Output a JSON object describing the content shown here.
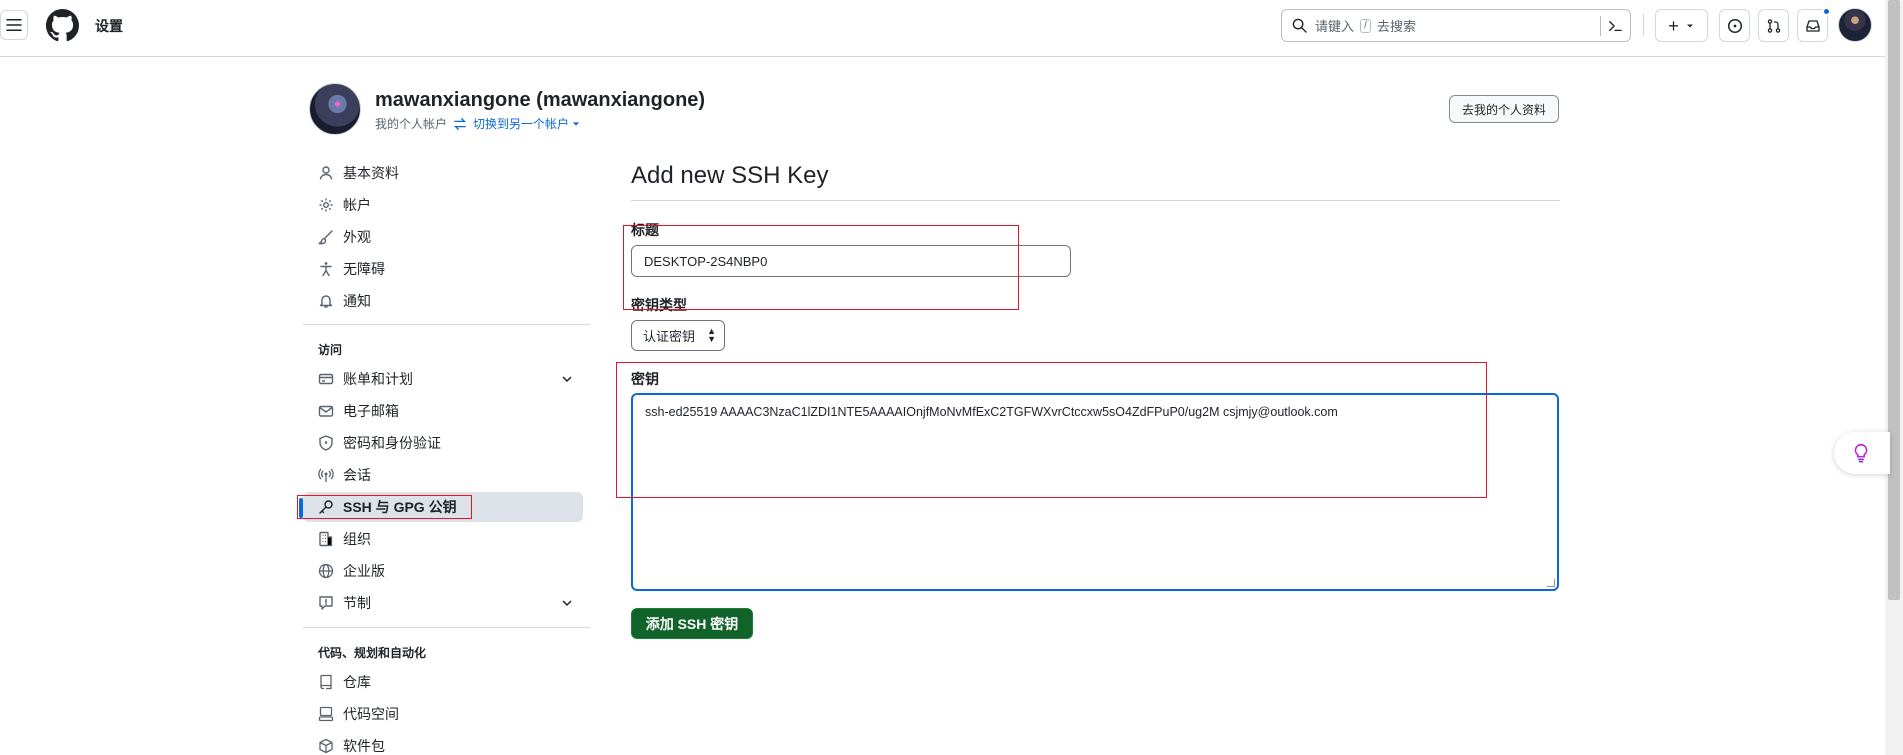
{
  "header": {
    "title": "设置",
    "search": {
      "placeholder_before": "请键入",
      "shortcut_key": "/",
      "placeholder_after": "去搜索"
    },
    "plus_label": "+"
  },
  "profile": {
    "name": "mawanxiangone (mawanxiangone)",
    "subtitle": "我的个人帐户",
    "switch_label": "切换到另一个帐户",
    "goto_profile_button": "去我的个人资料"
  },
  "sidebar": {
    "items": [
      {
        "label": "基本资料",
        "icon": "person-icon"
      },
      {
        "label": "帐户",
        "icon": "gear-icon"
      },
      {
        "label": "外观",
        "icon": "paintbrush-icon"
      },
      {
        "label": "无障碍",
        "icon": "accessibility-icon"
      },
      {
        "label": "通知",
        "icon": "bell-icon"
      }
    ],
    "access_heading": "访问",
    "access_items": [
      {
        "label": "账单和计划",
        "icon": "credit-card-icon",
        "expandable": true
      },
      {
        "label": "电子邮箱",
        "icon": "mail-icon"
      },
      {
        "label": "密码和身份验证",
        "icon": "shield-lock-icon"
      },
      {
        "label": "会话",
        "icon": "broadcast-icon"
      },
      {
        "label": "SSH 与 GPG 公钥",
        "icon": "key-icon",
        "active": true
      },
      {
        "label": "组织",
        "icon": "organization-icon"
      },
      {
        "label": "企业版",
        "icon": "globe-icon"
      },
      {
        "label": "节制",
        "icon": "report-icon",
        "expandable": true
      }
    ],
    "code_heading": "代码、规划和自动化",
    "code_items": [
      {
        "label": "仓库",
        "icon": "repo-icon"
      },
      {
        "label": "代码空间",
        "icon": "codespaces-icon"
      },
      {
        "label": "软件包",
        "icon": "package-icon"
      }
    ]
  },
  "form": {
    "page_title": "Add new SSH Key",
    "title_label": "标题",
    "title_value": "DESKTOP-2S4NBP0",
    "key_type_label": "密钥类型",
    "key_type_value": "认证密钥",
    "key_label": "密钥",
    "key_value": "ssh-ed25519 AAAAC3NzaC1lZDI1NTE5AAAAIOnjfMoNvMfExC2TGFWXvrCtccxw5sO4ZdFPuP0/ug2M csjmjy@outlook.com",
    "submit_label": "添加 SSH 密钥"
  },
  "colors": {
    "accent": "#0969da",
    "submit": "#116329",
    "annotation": "#e3142d"
  }
}
